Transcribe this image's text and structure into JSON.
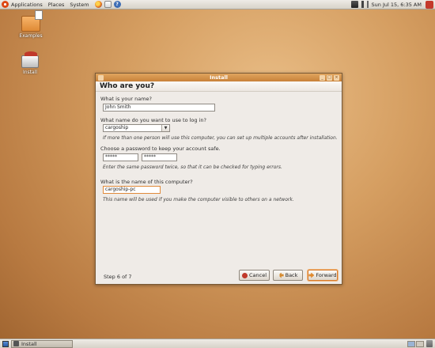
{
  "top_panel": {
    "menus": [
      "Applications",
      "Places",
      "System"
    ],
    "launchers": [
      "firefox-icon",
      "mail-icon",
      "help-icon"
    ],
    "clock": "Sun Jul 15,  6:35 AM"
  },
  "desktop": {
    "icons": [
      {
        "label": "Examples",
        "icon": "folder-icon"
      },
      {
        "label": "Install",
        "icon": "drive-icon"
      }
    ]
  },
  "window": {
    "title": "Install",
    "page_title": "Who are you?",
    "name_question": "What is your name?",
    "name_value": "John Smith",
    "login_question": "What name do you want to use to log in?",
    "login_value": "cargoship",
    "login_hint": "If more than one person will use this computer, you can set up multiple accounts after installation.",
    "password_question": "Choose a password to keep your account safe.",
    "password_value": "*****",
    "password_confirm_value": "*****",
    "password_hint": "Enter the same password twice, so that it can be checked for typing errors.",
    "computer_question": "What is the name of this computer?",
    "computer_value": "cargoship-pc",
    "computer_hint": "This name will be used if you make the computer visible to others on a network.",
    "step": "Step 6 of 7",
    "buttons": {
      "cancel": "Cancel",
      "back": "Back",
      "forward": "Forward"
    }
  },
  "bottom_panel": {
    "task": "Install"
  }
}
